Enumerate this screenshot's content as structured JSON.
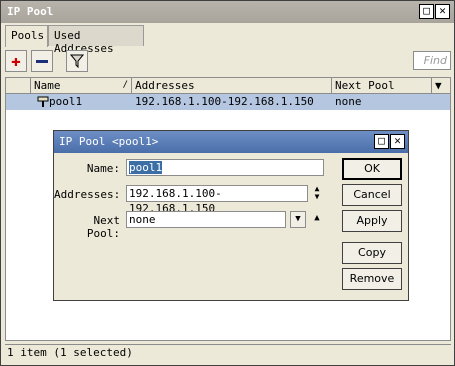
{
  "window": {
    "title": "IP Pool"
  },
  "tabs": [
    {
      "label": "Pools"
    },
    {
      "label": "Used Addresses"
    }
  ],
  "toolbar": {
    "find_placeholder": "Find"
  },
  "table": {
    "columns": [
      "Name",
      "Addresses",
      "Next Pool"
    ],
    "rows": [
      {
        "name": "pool1",
        "addresses": "192.168.1.100-192.168.1.150",
        "next_pool": "none"
      }
    ]
  },
  "status": "1 item (1 selected)",
  "dialog": {
    "title": "IP Pool <pool1>",
    "name_label": "Name:",
    "name_value": "pool1",
    "addresses_label": "Addresses:",
    "addresses_value": "192.168.1.100-192.168.1.150",
    "next_pool_label": "Next Pool:",
    "next_pool_value": "none",
    "buttons": {
      "ok": "OK",
      "cancel": "Cancel",
      "apply": "Apply",
      "copy": "Copy",
      "remove": "Remove"
    }
  },
  "colors": {
    "add": "#cc0000",
    "remove": "#1a2f7a",
    "selection": "#b4c6e0"
  }
}
